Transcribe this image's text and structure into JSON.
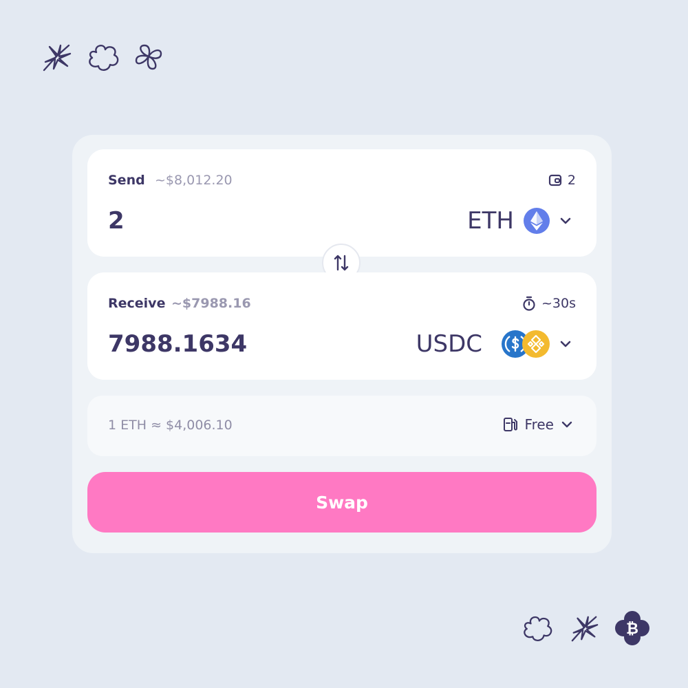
{
  "decorations": {
    "top": [
      "asterisk-flower-icon",
      "cloud-flower-icon",
      "pinwheel-flower-icon"
    ],
    "bottom": [
      "cloud-flower-icon",
      "asterisk-flower-icon",
      "bitcoin-flower-icon"
    ]
  },
  "send": {
    "label": "Send",
    "usd_value": "~$8,012.20",
    "wallet_balance": "2",
    "amount": "2",
    "token": "ETH",
    "token_icon": "ethereum-icon"
  },
  "receive": {
    "label": "Receive",
    "usd_value": "~$7988.16",
    "eta": "~30s",
    "amount": "7988.1634",
    "token": "USDC",
    "token_icons": [
      "usdc-icon",
      "bnb-chain-icon"
    ]
  },
  "rate": {
    "text": "1 ETH ≈ $4,006.10",
    "fee_label": "Free"
  },
  "swap_button": {
    "label": "Swap"
  },
  "colors": {
    "background": "#e3e9f2",
    "primary_text": "#3d3766",
    "secondary_text": "#9a98b0",
    "swap_button": "#ff79c3",
    "eth": "#627eea",
    "usdc": "#2775ca",
    "bnb": "#f3ba2f"
  }
}
